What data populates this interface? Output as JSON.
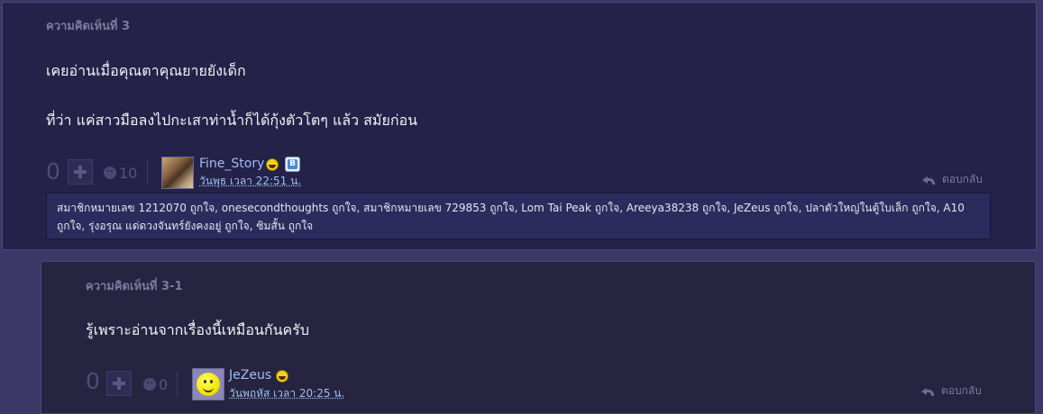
{
  "comments": [
    {
      "label": "ความคิดเห็นที่ 3",
      "paragraphs": [
        "เคยอ่านเมื่อคุณตาคุณยายยังเด็ก",
        "ที่ว่า แค่สาวมือลงไปกะเสาท่าน้ำก็ได้กุ้งตัวโตๆ แล้ว สมัยก่อน"
      ],
      "votes": "0",
      "emotions": "10",
      "user": {
        "name": "Fine_Story",
        "avatar": "photo",
        "badges": [
          "laugh-emoji",
          "blog-badge"
        ]
      },
      "timestamp": "วันพุธ เวลา 22:51 น.",
      "reply_label": "ตอบกลับ",
      "likes": "สมาชิกหมายเลข 1212070 ถูกใจ, onesecondthoughts ถูกใจ, สมาชิกหมายเลข 729853 ถูกใจ, Lom Tai Peak ถูกใจ, Areeya38238 ถูกใจ, JeZeus ถูกใจ, ปลาตัวใหญ่ในตู้ใบเล็ก ถูกใจ, A10 ถูกใจ, รุ่งอรุณ แด่ดวงจันทร์ยังคงอยู่ ถูกใจ, ซิมสั้น ถูกใจ"
    },
    {
      "label": "ความคิดเห็นที่ 3-1",
      "paragraphs": [
        "รู้เพราะอ่านจากเรื่องนี้เหมือนกันครับ"
      ],
      "votes": "0",
      "emotions": "0",
      "user": {
        "name": "JeZeus",
        "avatar": "smiley",
        "badges": [
          "laugh-emoji"
        ]
      },
      "timestamp": "วันพฤหัส เวลา 20:25 น.",
      "reply_label": "ตอบกลับ"
    }
  ],
  "icons": {
    "vote_plus": "plus-icon",
    "emotion": "emotion-icon",
    "reply": "reply-icon",
    "laugh": "laugh-emoji-icon",
    "blog": "blog-badge-icon"
  },
  "colors": {
    "background": "#3b3766",
    "card": "#242248",
    "username": "#9fbef5",
    "label": "#7f7b9e"
  }
}
